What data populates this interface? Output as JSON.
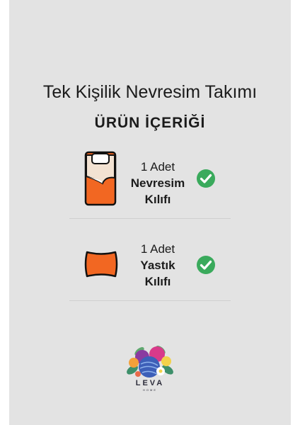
{
  "header": {
    "title": "Tek Kişilik Nevresim Takımı",
    "subtitle": "ÜRÜN İÇERİĞİ"
  },
  "items": [
    {
      "quantity": "1 Adet",
      "name_line1": "Nevresim",
      "name_line2": "Kılıfı",
      "icon": "duvet-cover-icon",
      "status_icon": "check-circle-icon"
    },
    {
      "quantity": "1 Adet",
      "name_line1": "Yastık",
      "name_line2": "Kılıfı",
      "icon": "pillow-icon",
      "status_icon": "check-circle-icon"
    }
  ],
  "brand": {
    "name": "LEVA",
    "tagline": "HOME"
  },
  "colors": {
    "background": "#e3e3e3",
    "accent_orange": "#f26722",
    "check_green": "#3aaa5c",
    "text": "#1b1b1b"
  }
}
